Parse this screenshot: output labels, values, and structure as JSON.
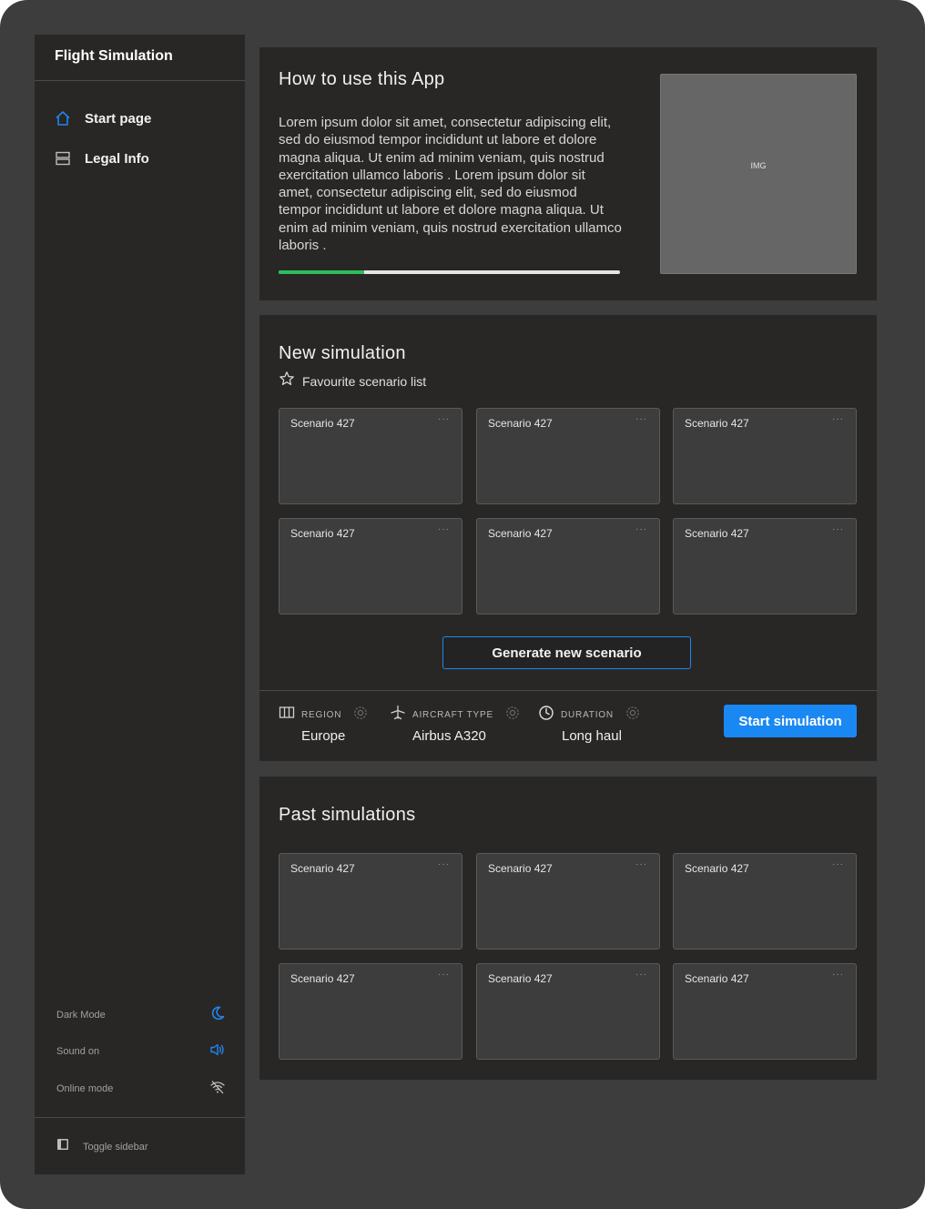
{
  "app_title": "Flight Simulation",
  "sidebar": {
    "nav": [
      {
        "label": "Start page",
        "icon": "home-icon"
      },
      {
        "label": "Legal Info",
        "icon": "server-icon"
      }
    ],
    "settings": [
      {
        "label": "Dark Mode",
        "icon": "moon-icon"
      },
      {
        "label": "Sound on",
        "icon": "speaker-icon"
      },
      {
        "label": "Online mode",
        "icon": "wifi-off-icon"
      }
    ],
    "toggle_label": "Toggle sidebar"
  },
  "how_to": {
    "title": "How to use this App",
    "body": "Lorem ipsum dolor sit amet, consectetur adipiscing elit, sed do eiusmod tempor incididunt ut labore et dolore magna aliqua. Ut enim ad minim veniam, quis nostrud exercitation ullamco laboris . Lorem ipsum dolor sit amet, consectetur adipiscing elit, sed do eiusmod tempor incididunt ut labore et dolore magna aliqua. Ut enim ad minim veniam, quis nostrud exercitation ullamco laboris .",
    "progress": 0.25,
    "image_label": "IMG"
  },
  "new_simulation": {
    "title": "New simulation",
    "favourite_label": "Favourite scenario list",
    "cards": [
      {
        "title": "Scenario 427",
        "menu": "···"
      },
      {
        "title": "Scenario 427",
        "menu": "···"
      },
      {
        "title": "Scenario 427",
        "menu": "···"
      },
      {
        "title": "Scenario 427",
        "menu": "···"
      },
      {
        "title": "Scenario 427",
        "menu": "···"
      },
      {
        "title": "Scenario 427",
        "menu": "···"
      }
    ],
    "generate_label": "Generate new scenario",
    "params": [
      {
        "label": "REGION",
        "value": "Europe",
        "icon": "map-icon"
      },
      {
        "label": "AIRCRAFT TYPE",
        "value": "Airbus A320",
        "icon": "airplane-icon"
      },
      {
        "label": "DURATION",
        "value": "Long haul",
        "icon": "clock-icon"
      }
    ],
    "start_label": "Start simulation"
  },
  "past_simulations": {
    "title": "Past simulations",
    "cards": [
      {
        "title": "Scenario 427",
        "menu": "···"
      },
      {
        "title": "Scenario 427",
        "menu": "···"
      },
      {
        "title": "Scenario 427",
        "menu": "···"
      },
      {
        "title": "Scenario 427",
        "menu": "···"
      },
      {
        "title": "Scenario 427",
        "menu": "···"
      },
      {
        "title": "Scenario 427",
        "menu": "···"
      }
    ]
  },
  "colors": {
    "accent_blue": "#1a88f2",
    "progress_green": "#2ebd5c",
    "panel": "#282726",
    "background": "#3d3d3d"
  }
}
